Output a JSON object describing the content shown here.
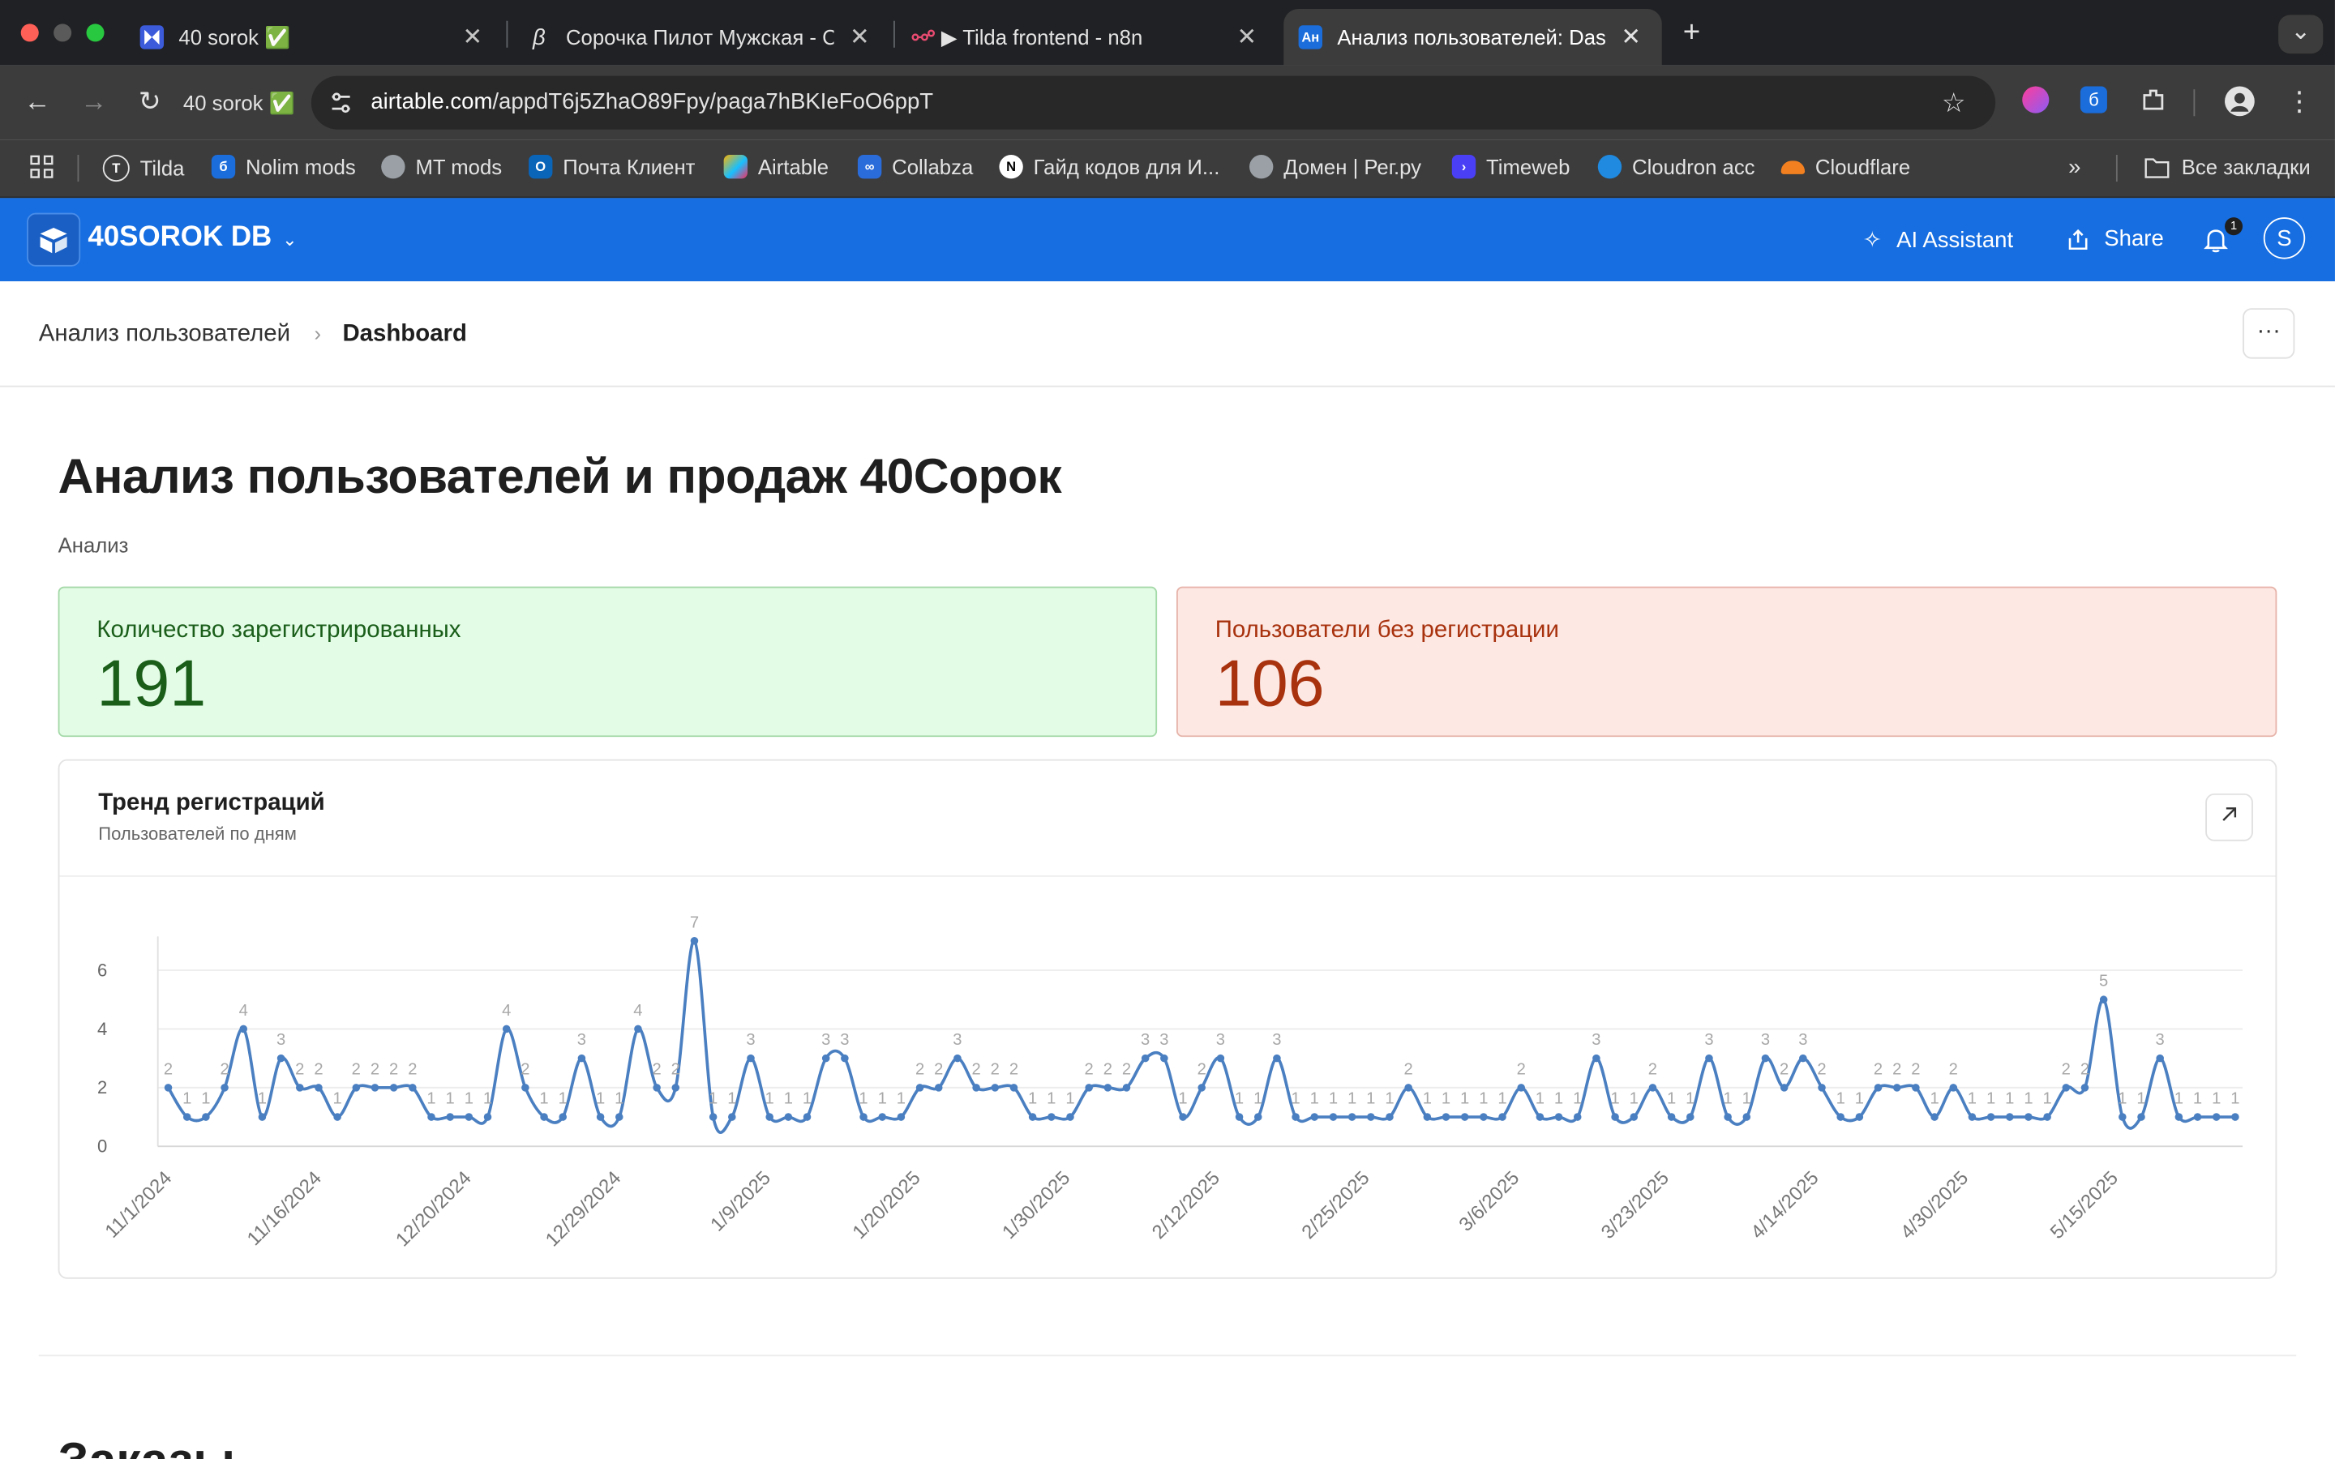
{
  "browser": {
    "tabs": [
      {
        "title": "40 sorok ✅",
        "icon_color": "#3b5bdb"
      },
      {
        "title": "Сорочка Пилот Мужская - С",
        "icon_color": "#2a2a2a"
      },
      {
        "title": "▶ Tilda frontend - n8n",
        "icon_color": "#ea4b71"
      },
      {
        "title": "Анализ пользователей: Dash",
        "icon_color": "#1a6ddb",
        "icon_text": "Ан"
      }
    ],
    "profile_label": "40 sorok ✅",
    "url_domain": "airtable.com",
    "url_path": "/appdT6j5ZhaO89Fpy/paga7hBKIeFoO6ppT",
    "bookmarks": [
      "Tilda",
      "Nolim mods",
      "MT mods",
      "Почта Клиент",
      "Airtable",
      "Collabza",
      "Гайд кодов для И...",
      "Домен | Рег.ру",
      "Timeweb",
      "Cloudron acc",
      "Cloudflare"
    ],
    "all_bookmarks": "Все закладки"
  },
  "header": {
    "base_name": "40SOROK DB",
    "ai_assistant": "AI Assistant",
    "share": "Share",
    "notification_count": "1",
    "avatar_letter": "S"
  },
  "breadcrumb": {
    "parent": "Анализ пользователей",
    "current": "Dashboard",
    "more": "···"
  },
  "dashboard": {
    "title": "Анализ пользователей и продаж 40Сорок",
    "description": "Анализ",
    "cards": [
      {
        "label": "Количество зарегистрированных",
        "value": "191"
      },
      {
        "label": "Пользователи без регистрации",
        "value": "106"
      }
    ],
    "chart_title": "Тренд регистраций",
    "chart_subtitle": "Пользователей по дням",
    "next_section": "Заказы"
  },
  "colors": {
    "line": "#4a7fc1",
    "label": "#a8a8a8",
    "brand": "#166ee1"
  },
  "chart_data": {
    "type": "line",
    "title": "Тренд регистраций",
    "subtitle": "Пользователей по дням",
    "ylim": [
      0,
      7
    ],
    "yticks": [
      0,
      2,
      4,
      6
    ],
    "xtick_labels": [
      "11/1/2024",
      "11/16/2024",
      "12/20/2024",
      "12/29/2024",
      "1/9/2025",
      "1/20/2025",
      "1/30/2025",
      "2/12/2025",
      "2/25/2025",
      "3/6/2025",
      "3/23/2025",
      "4/14/2025",
      "4/30/2025",
      "5/15/2025"
    ],
    "values": [
      2,
      1,
      1,
      2,
      4,
      1,
      3,
      2,
      2,
      1,
      2,
      2,
      2,
      2,
      1,
      1,
      1,
      1,
      4,
      2,
      1,
      1,
      3,
      1,
      1,
      4,
      2,
      2,
      7,
      1,
      1,
      3,
      1,
      1,
      1,
      3,
      3,
      1,
      1,
      1,
      2,
      2,
      3,
      2,
      2,
      2,
      1,
      1,
      1,
      2,
      2,
      2,
      3,
      3,
      1,
      2,
      3,
      1,
      1,
      3,
      1,
      1,
      1,
      1,
      1,
      1,
      2,
      1,
      1,
      1,
      1,
      1,
      2,
      1,
      1,
      1,
      3,
      1,
      1,
      2,
      1,
      1,
      3,
      1,
      1,
      3,
      2,
      3,
      2,
      1,
      1,
      2,
      2,
      2,
      1,
      2,
      1,
      1,
      1,
      1,
      1,
      2,
      2,
      5,
      1,
      1,
      3,
      1,
      1,
      1,
      1
    ],
    "grid": true
  }
}
